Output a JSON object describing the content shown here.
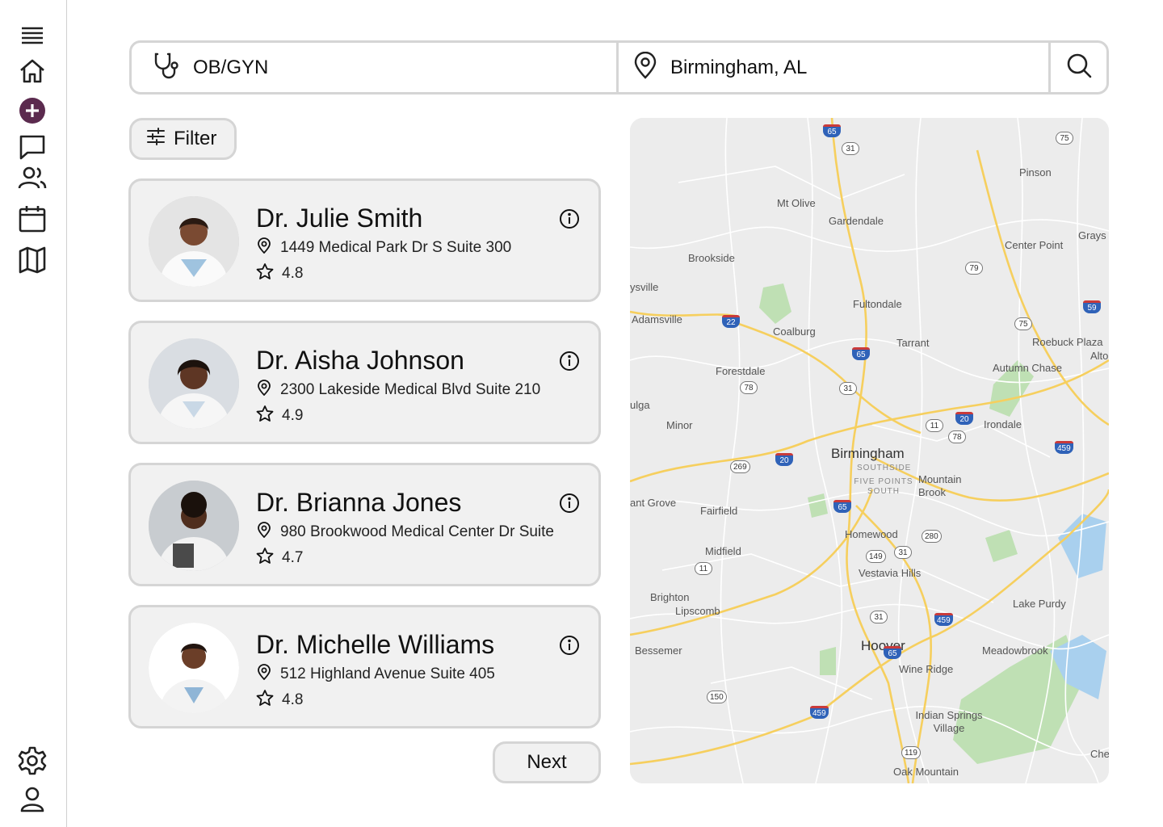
{
  "sidebar": {
    "top_icons": [
      "menu-icon",
      "home-icon",
      "add-icon",
      "chat-icon",
      "users-icon",
      "calendar-icon",
      "map-icon"
    ],
    "bottom_icons": [
      "settings-icon",
      "profile-icon"
    ],
    "accent_color": "#5b2a4e"
  },
  "search": {
    "specialty_value": "OB/GYN",
    "location_value": "Birmingham, AL"
  },
  "filter": {
    "label": "Filter"
  },
  "doctors": [
    {
      "name": "Dr. Julie Smith",
      "address": "1449 Medical Park Dr S Suite 300",
      "rating": "4.8"
    },
    {
      "name": "Dr. Aisha Johnson",
      "address": "2300 Lakeside Medical Blvd Suite 210",
      "rating": "4.9"
    },
    {
      "name": "Dr. Brianna Jones",
      "address": "980 Brookwood Medical Center Dr Suite",
      "rating": "4.7"
    },
    {
      "name": "Dr. Michelle Williams",
      "address": "512 Highland Avenue Suite 405",
      "rating": "4.8"
    }
  ],
  "pagination": {
    "next_label": "Next"
  },
  "map": {
    "labels": [
      "Mt Olive",
      "Gardendale",
      "Pinson",
      "Center Point",
      "Grays Valle",
      "Brookside",
      "Fultondale",
      "ysville",
      "Adamsville",
      "Coalburg",
      "Tarrant",
      "Roebuck Plaza",
      "Alto",
      "Forestdale",
      "Autumn Chase",
      "ulga",
      "Minor",
      "Irondale",
      "Birmingham",
      "SOUTHSIDE",
      "FIVE POINTS SOUTH",
      "Mountain Brook",
      "ant Grove",
      "Fairfield",
      "Homewood",
      "Midfield",
      "Vestavia Hills",
      "Brighton",
      "Lipscomb",
      "Lake Purdy",
      "Bessemer",
      "Hoover",
      "Meadowbrook",
      "Wine Ridge",
      "Indian Springs Village",
      "Oak Mountain",
      "Che"
    ],
    "shields": [
      "65",
      "31",
      "75",
      "79",
      "22",
      "59",
      "75",
      "65",
      "31",
      "78",
      "11",
      "20",
      "78",
      "459",
      "20",
      "269",
      "65",
      "280",
      "149",
      "31",
      "11",
      "31",
      "459",
      "65",
      "150",
      "459",
      "119"
    ]
  }
}
